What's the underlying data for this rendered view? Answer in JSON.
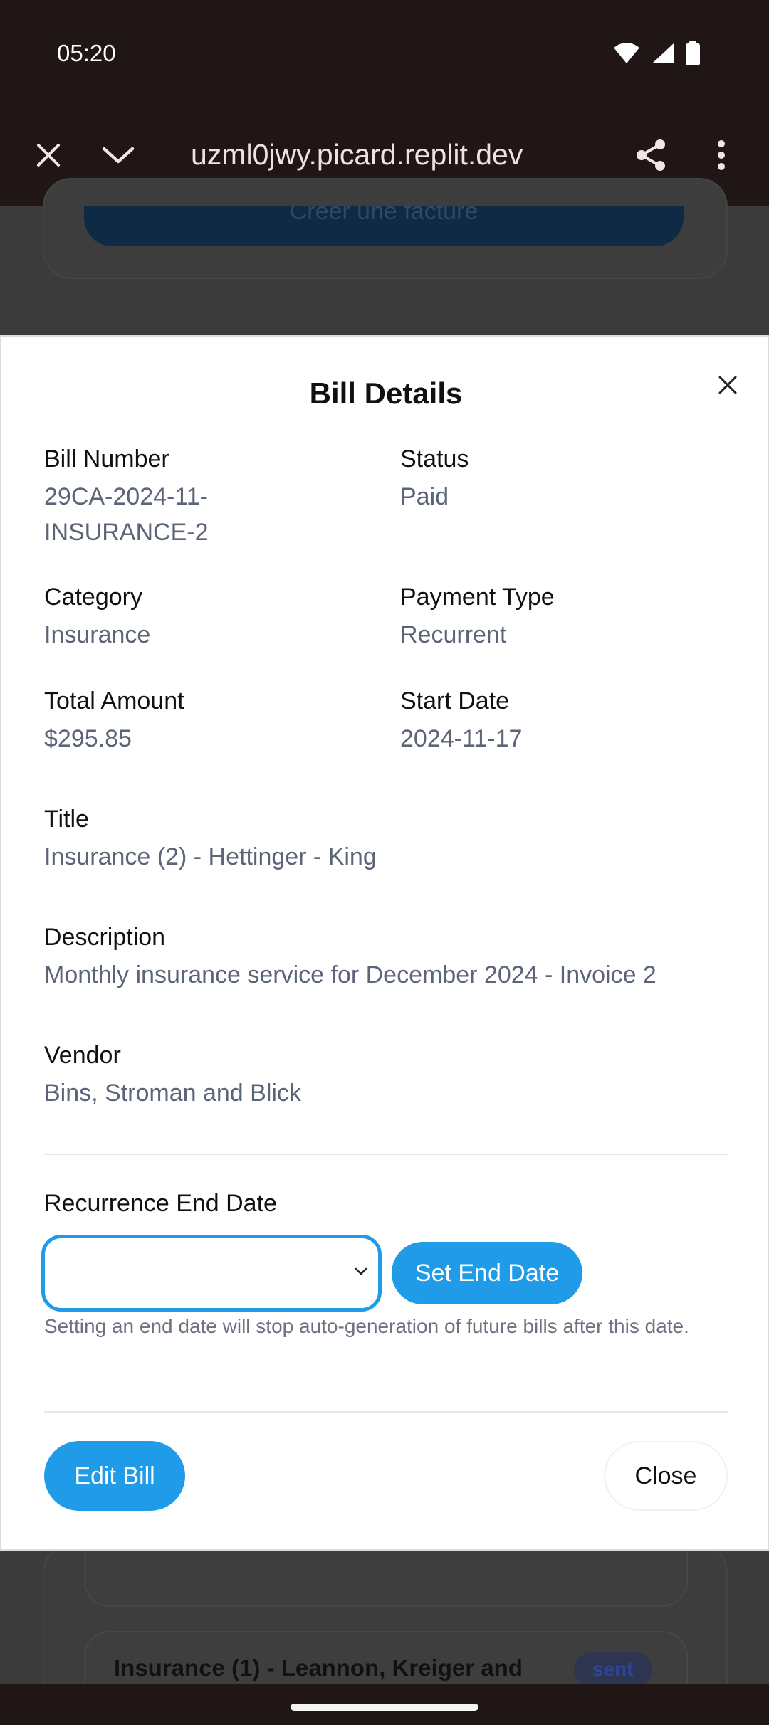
{
  "status_bar": {
    "time": "05:20"
  },
  "browser": {
    "url": "uzml0jwy.picard.replit.dev"
  },
  "background": {
    "top_button_label": "Créer une facture",
    "list_item_title": "Insurance (1) - Leannon, Kreiger and",
    "list_item_badge": "sent"
  },
  "modal": {
    "title": "Bill Details",
    "fields": {
      "bill_number": {
        "label": "Bill Number",
        "value": "29CA-2024-11-\nINSURANCE-2"
      },
      "status": {
        "label": "Status",
        "value": "Paid"
      },
      "category": {
        "label": "Category",
        "value": "Insurance"
      },
      "payment_type": {
        "label": "Payment Type",
        "value": "Recurrent"
      },
      "total_amount": {
        "label": "Total Amount",
        "value": "$295.85"
      },
      "start_date": {
        "label": "Start Date",
        "value": "2024-11-17"
      },
      "title": {
        "label": "Title",
        "value": "Insurance (2) - Hettinger - King"
      },
      "description": {
        "label": "Description",
        "value": "Monthly insurance service for December 2024 - Invoice 2"
      },
      "vendor": {
        "label": "Vendor",
        "value": "Bins, Stroman and Blick"
      }
    },
    "recurrence": {
      "label": "Recurrence End Date",
      "select_value": "",
      "set_button": "Set End Date",
      "help": "Setting an end date will stop auto-generation of future bills after this date."
    },
    "actions": {
      "edit": "Edit Bill",
      "close": "Close"
    }
  }
}
